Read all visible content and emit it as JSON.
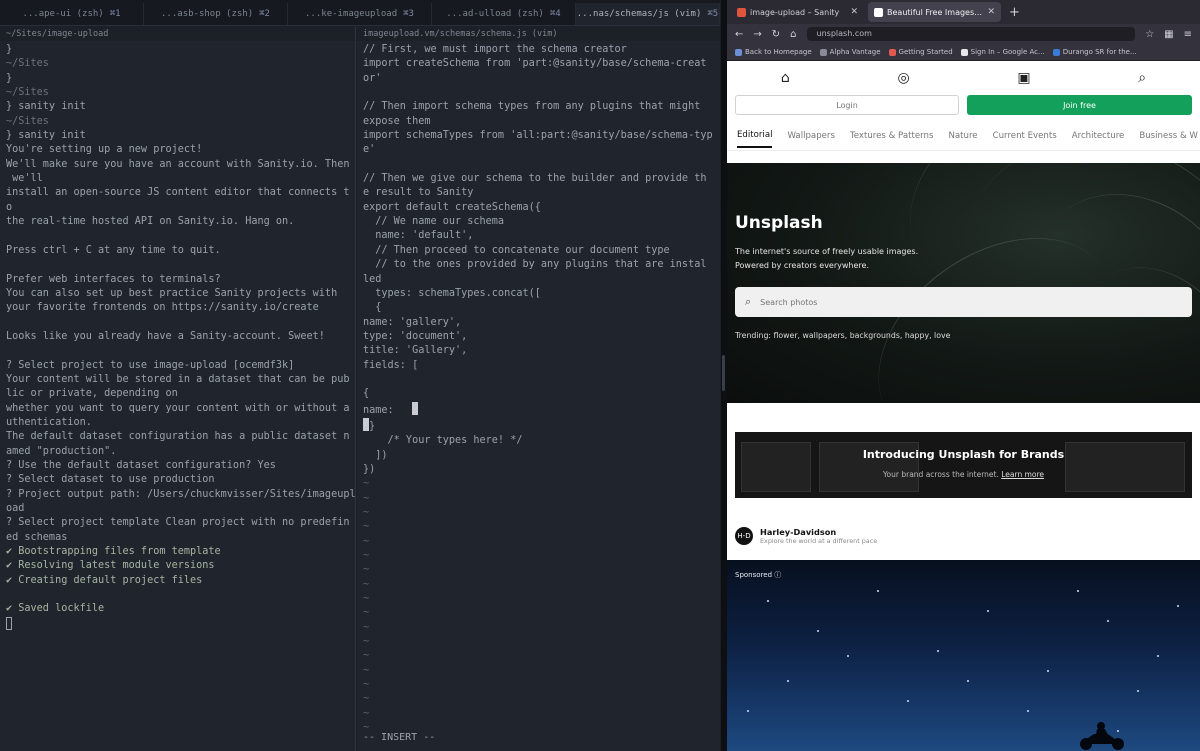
{
  "terminal": {
    "tabs": [
      {
        "title": "...ape-ui (zsh)",
        "key": "⌘1"
      },
      {
        "title": "...asb-shop (zsh)",
        "key": "⌘2"
      },
      {
        "title": "...ke-imageupload",
        "key": "⌘3"
      },
      {
        "title": "...ad-ulload (zsh)",
        "key": "⌘4"
      },
      {
        "title": "...nas/schemas/js (vim)",
        "key": "⌘5"
      }
    ],
    "left_title": "~/Sites/image-upload",
    "left_lines": [
      {
        "t": "}",
        "c": ""
      },
      {
        "t": "~/Sites",
        "c": "gray"
      },
      {
        "t": "}",
        "c": ""
      },
      {
        "t": "~/Sites",
        "c": "gray"
      },
      {
        "t": "} sanity init",
        "c": ""
      },
      {
        "t": "~/Sites",
        "c": "gray"
      },
      {
        "t": "} sanity init",
        "c": ""
      },
      {
        "t": "You're setting up a new project!",
        "c": ""
      },
      {
        "t": "We'll make sure you have an account with Sanity.io. Then",
        "c": ""
      },
      {
        "t": " we'll",
        "c": ""
      },
      {
        "t": "install an open-source JS content editor that connects t",
        "c": ""
      },
      {
        "t": "o",
        "c": ""
      },
      {
        "t": "the real-time hosted API on Sanity.io. Hang on.",
        "c": ""
      },
      {
        "t": "",
        "c": ""
      },
      {
        "t": "Press ctrl + C at any time to quit.",
        "c": ""
      },
      {
        "t": "",
        "c": ""
      },
      {
        "t": "Prefer web interfaces to terminals?",
        "c": ""
      },
      {
        "t": "You can also set up best practice Sanity projects with",
        "c": ""
      },
      {
        "t": "your favorite frontends on https://sanity.io/create",
        "c": ""
      },
      {
        "t": "",
        "c": ""
      },
      {
        "t": "Looks like you already have a Sanity-account. Sweet!",
        "c": ""
      },
      {
        "t": "",
        "c": ""
      },
      {
        "t": "? Select project to use image-upload [ocemdf3k]",
        "c": ""
      },
      {
        "t": "Your content will be stored in a dataset that can be pub",
        "c": ""
      },
      {
        "t": "lic or private, depending on",
        "c": ""
      },
      {
        "t": "whether you want to query your content with or without a",
        "c": ""
      },
      {
        "t": "uthentication.",
        "c": ""
      },
      {
        "t": "The default dataset configuration has a public dataset n",
        "c": ""
      },
      {
        "t": "amed \"production\".",
        "c": ""
      },
      {
        "t": "? Use the default dataset configuration? Yes",
        "c": ""
      },
      {
        "t": "? Select dataset to use production",
        "c": ""
      },
      {
        "t": "? Project output path: /Users/chuckmvisser/Sites/imageupl",
        "c": ""
      },
      {
        "t": "oad",
        "c": ""
      },
      {
        "t": "? Select project template Clean project with no predefin",
        "c": ""
      },
      {
        "t": "ed schemas",
        "c": ""
      },
      {
        "t": "✔ Bootstrapping files from template",
        "c": "green"
      },
      {
        "t": "✔ Resolving latest module versions",
        "c": "green"
      },
      {
        "t": "✔ Creating default project files",
        "c": "green"
      },
      {
        "t": "",
        "c": ""
      },
      {
        "t": "✔ Saved lockfile",
        "c": "green"
      }
    ],
    "right_title": "imageupload.vm/schemas/schema.js (vim)",
    "code_lines": [
      "// First, we must import the schema creator",
      "import createSchema from 'part:@sanity/base/schema-creat",
      "or'",
      "",
      "// Then import schema types from any plugins that might",
      "expose them",
      "import schemaTypes from 'all:part:@sanity/base/schema-typ",
      "e'",
      "",
      "// Then we give our schema to the builder and provide th",
      "e result to Sanity",
      "export default createSchema({",
      "  // We name our schema",
      "  name: 'default',",
      "  // Then proceed to concatenate our document type",
      "  // to the ones provided by any plugins that are instal",
      "led",
      "  types: schemaTypes.concat([",
      "  {",
      "name: 'gallery',",
      "type: 'document',",
      "title: 'Gallery',",
      "fields: [",
      "",
      "{",
      "name:   ",
      "}",
      "    /* Your types here! */",
      "  ])",
      "})"
    ],
    "mode": "-- INSERT --"
  },
  "browser": {
    "tabs": [
      {
        "title": "image-upload – Sanity",
        "favicon": "#e0533d"
      },
      {
        "title": "Beautiful Free Images & Pictures | Unsplash",
        "favicon": "#ffffff"
      }
    ],
    "url": "unsplash.com",
    "bookmarks": [
      "Back to Homepage",
      "Alpha Vantage",
      "Getting Started",
      "Sign In – Google Ac...",
      "Durango SR for the..."
    ],
    "nav_icons": [
      "home-icon",
      "explore-icon",
      "collections-icon",
      "search-icon"
    ],
    "login_label": "Login",
    "join_label": "Join free",
    "topics": [
      "Editorial",
      "Wallpapers",
      "Textures & Patterns",
      "Nature",
      "Current Events",
      "Architecture",
      "Business & W"
    ],
    "hero": {
      "title": "Unsplash",
      "subtitle_1": "The internet's source of freely usable images.",
      "subtitle_2": "Powered by creators everywhere.",
      "search_placeholder": "Search photos",
      "trending": "Trending: flower, wallpapers, backgrounds, happy, love"
    },
    "brands": {
      "title": "Introducing Unsplash for Brands",
      "subtitle": "Your brand across the internet.",
      "link": "Learn more"
    },
    "sponsor": {
      "name": "Harley-Davidson",
      "tagline": "Explore the world at a different pace",
      "label": "Sponsored"
    },
    "colors": {
      "join_green": "#12a05a",
      "terminal_bg": "#20242c",
      "browser_chrome": "#2b2a33"
    }
  }
}
